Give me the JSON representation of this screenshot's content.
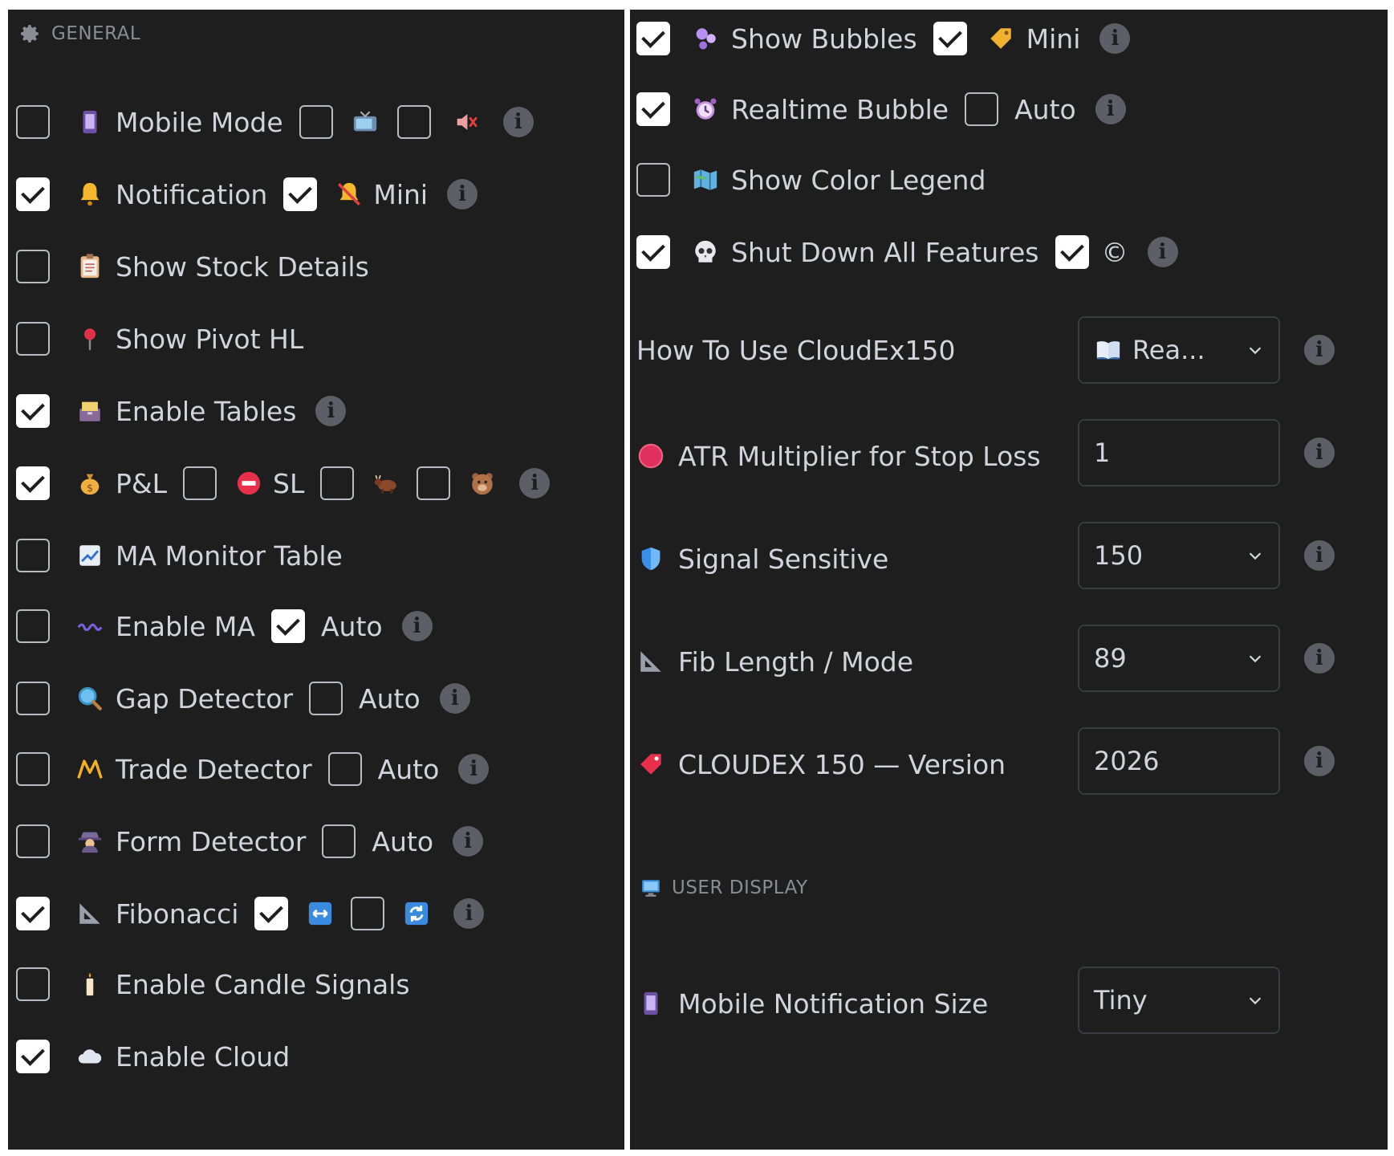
{
  "general": {
    "header": "GENERAL",
    "rows": [
      {
        "label": "Mobile Mode",
        "checked": false,
        "extra": [
          {
            "checked": false,
            "icon": "tv-icon"
          },
          {
            "checked": false,
            "icon": "muted-speaker-icon"
          }
        ]
      },
      {
        "label": "Notification",
        "checked": true,
        "extra_checked": true,
        "extra_label": "Mini"
      },
      {
        "label": "Show Stock Details",
        "checked": false
      },
      {
        "label": "Show Pivot HL",
        "checked": false
      },
      {
        "label": "Enable Tables",
        "checked": true
      },
      {
        "label": "P&L",
        "checked": true,
        "sl_label": "SL",
        "extras": [
          false,
          false,
          false
        ]
      },
      {
        "label": "MA Monitor Table",
        "checked": false
      },
      {
        "label": "Enable MA",
        "checked": false,
        "auto_checked": true,
        "auto_label": "Auto"
      },
      {
        "label": "Gap Detector",
        "checked": false,
        "auto_checked": false,
        "auto_label": "Auto"
      },
      {
        "label": "Trade Detector",
        "checked": false,
        "auto_checked": false,
        "auto_label": "Auto"
      },
      {
        "label": "Form Detector",
        "checked": false,
        "auto_checked": false,
        "auto_label": "Auto"
      },
      {
        "label": "Fibonacci",
        "checked": true,
        "extras": [
          true,
          false
        ]
      },
      {
        "label": "Enable Candle Signals",
        "checked": false
      },
      {
        "label": "Enable Cloud",
        "checked": true
      }
    ]
  },
  "right": {
    "rows": [
      {
        "label": "Show Bubbles",
        "checked": true,
        "extra_checked": true,
        "extra_label": "Mini"
      },
      {
        "label": "Realtime Bubble",
        "checked": true,
        "extra_checked": false,
        "extra_label": "Auto"
      },
      {
        "label": "Show Color Legend",
        "checked": false
      },
      {
        "label": "Shut Down All Features",
        "checked": true,
        "extra_checked": true,
        "extra_label": "©"
      }
    ],
    "settings": [
      {
        "label": "How To Use CloudEx150",
        "value": "Rea...",
        "type": "select"
      },
      {
        "label": "ATR Multiplier for Stop Loss",
        "value": "1",
        "type": "input"
      },
      {
        "label": "Signal Sensitive",
        "value": "150",
        "type": "select"
      },
      {
        "label": "Fib Length / Mode",
        "value": "89",
        "type": "select"
      },
      {
        "label": "CLOUDEX 150 — Version",
        "value": "2026",
        "type": "input"
      }
    ],
    "user_display": {
      "header": "USER DISPLAY",
      "label": "Mobile Notification Size",
      "value": "Tiny"
    }
  },
  "colors": {
    "panel_bg": "#1e1e1e",
    "text": "#d1d4dc",
    "muted": "#8a8d96",
    "info_bg": "#5c5f66"
  }
}
